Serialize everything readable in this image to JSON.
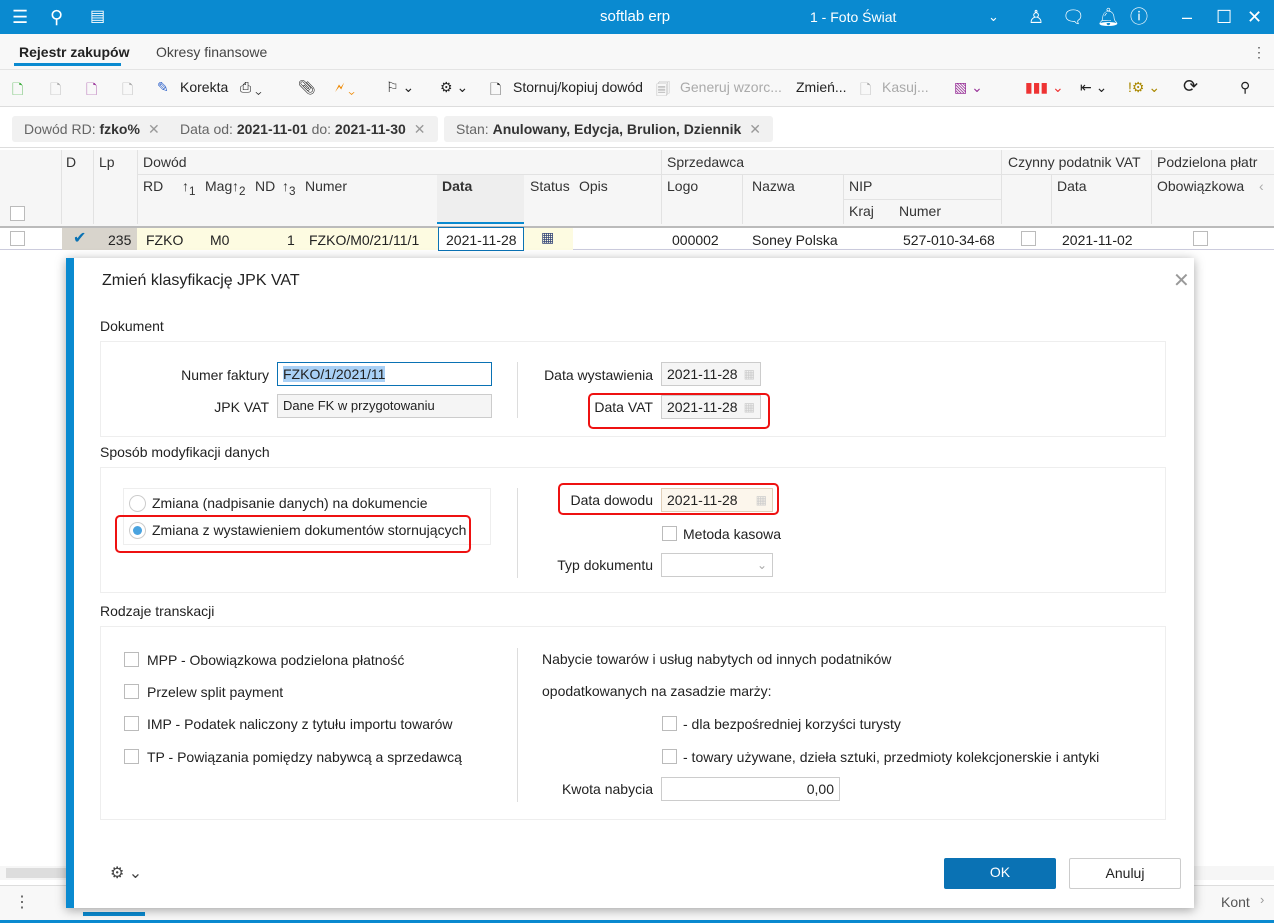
{
  "titlebar": {
    "app": "softlab erp",
    "company": "1 - Foto Świat"
  },
  "tabs": [
    {
      "label": "Rejestr zakupów",
      "active": true
    },
    {
      "label": "Okresy finansowe"
    }
  ],
  "toolbar": {
    "korekta": "Korekta",
    "stornuj": "Stornuj/kopiuj dowód",
    "generuj": "Generuj wzorc...",
    "zmien": "Zmień...",
    "kasuj": "Kasuj..."
  },
  "filters": [
    {
      "label": "Dowód RD:",
      "value": "fzko%"
    },
    {
      "label": "Data od:",
      "value": "2021-11-01",
      "label2": "do:",
      "value2": "2021-11-30"
    },
    {
      "label": "Stan:",
      "value": "Anulowany, Edycja, Brulion, Dziennik"
    }
  ],
  "grid": {
    "headers": {
      "d": "D",
      "lp": "Lp",
      "dowod": "Dowód",
      "rd": "RD",
      "mag": "Mag",
      "nd": "ND",
      "numer": "Numer",
      "data": "Data",
      "status": "Status",
      "opis": "Opis",
      "sprzedawca": "Sprzedawca",
      "logo": "Logo",
      "nazwa": "Nazwa",
      "nip": "NIP",
      "kraj": "Kraj",
      "nip_numer": "Numer",
      "czynny": "Czynny podatnik VAT",
      "czynny_data": "Data",
      "podzielona": "Podzielona płatr",
      "obowiazkowa": "Obowiązkowa",
      "sort1": "1",
      "sort2": "2",
      "sort3": "3"
    },
    "row": {
      "lp": "235",
      "rd": "FZKO",
      "mag": "M0",
      "nd": "1",
      "numer": "FZKO/M0/21/11/1",
      "data": "2021-11-28",
      "logo": "000002",
      "nazwa": "Soney Polska",
      "nip": "527-010-34-68",
      "czynny_data": "2021-11-02",
      "d_checked": true
    }
  },
  "bottom": {
    "right_label": "Kont"
  },
  "dialog": {
    "title": "Zmień klasyfikację JPK VAT",
    "sections": {
      "dokument": "Dokument",
      "sposob": "Sposób modyfikacji danych",
      "rodzaje": "Rodzaje transkacji"
    },
    "numer_faktury": {
      "label": "Numer faktury",
      "value": "FZKO/1/2021/11"
    },
    "jpk_vat": {
      "label": "JPK VAT",
      "value": "Dane FK w przygotowaniu"
    },
    "data_wystawienia": {
      "label": "Data wystawienia",
      "value": "2021-11-28"
    },
    "data_vat": {
      "label": "Data VAT",
      "value": "2021-11-28"
    },
    "radio1": "Zmiana (nadpisanie danych)  na dokumencie",
    "radio2": "Zmiana z wystawieniem dokumentów stornujących",
    "selected_radio": 2,
    "data_dowodu": {
      "label": "Data dowodu",
      "value": "2021-11-28"
    },
    "metoda_kasowa": "Metoda kasowa",
    "typ_dokumentu": {
      "label": "Typ dokumentu",
      "value": ""
    },
    "checks_left": [
      "MPP - Obowiązkowa podzielona płatność",
      "Przelew split payment",
      "IMP - Podatek naliczony z tytułu importu towarów",
      "TP - Powiązania pomiędzy nabywcą a sprzedawcą"
    ],
    "nabycie_line1": "Nabycie towarów i usług nabytych od innych podatników",
    "nabycie_line2": "opodatkowanych na zasadzie marży:",
    "checks_right": [
      "- dla bezpośredniej korzyści turysty",
      "- towary używane, dzieła sztuki, przedmioty kolekcjonerskie i antyki"
    ],
    "kwota": {
      "label": "Kwota nabycia",
      "value": "0,00"
    },
    "ok": "OK",
    "cancel": "Anuluj"
  },
  "colors": {
    "accent": "#0a8ad0",
    "ok_button": "#0a72b4",
    "highlight": "#e11111"
  }
}
